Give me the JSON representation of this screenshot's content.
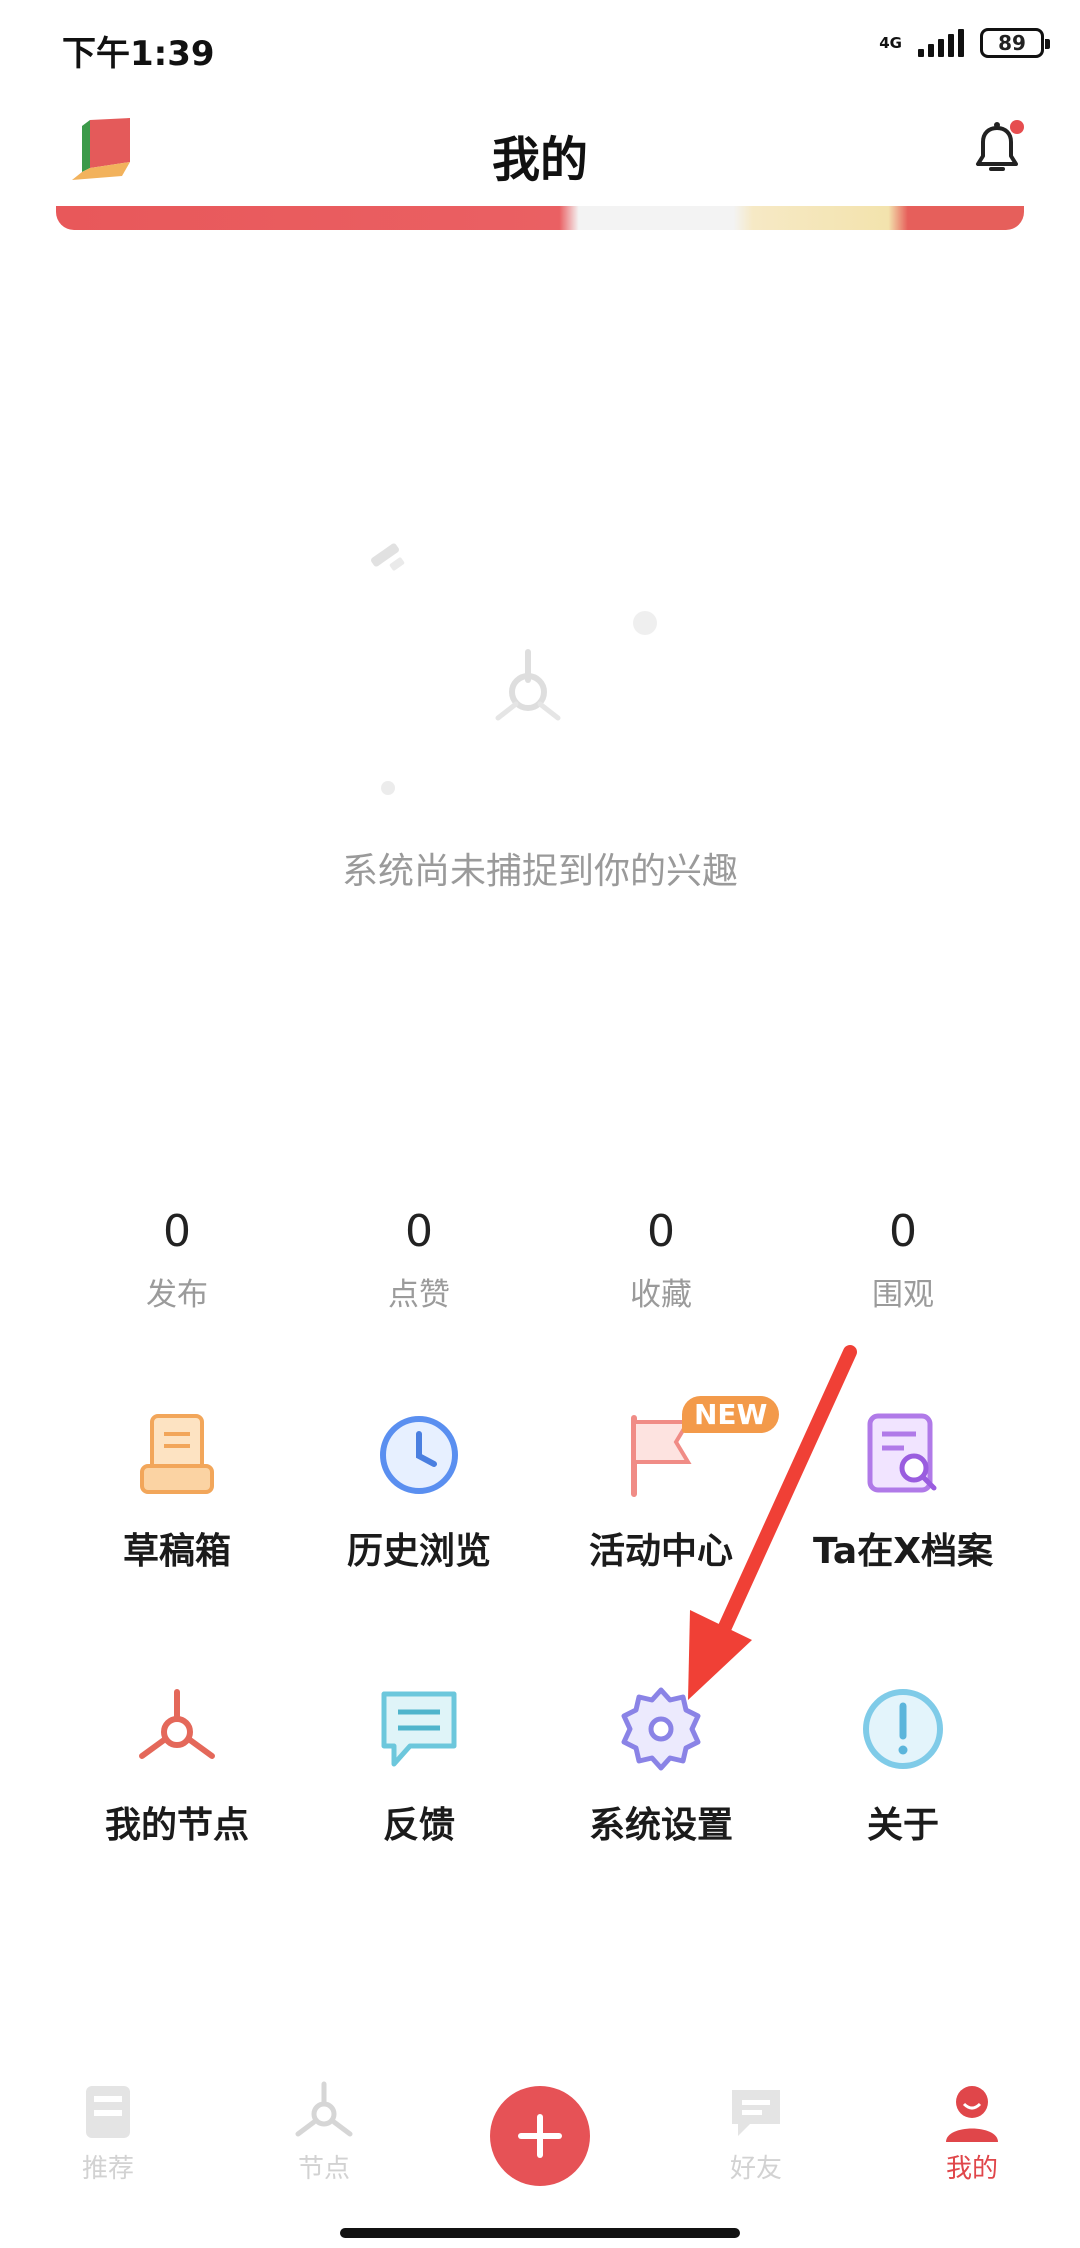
{
  "status": {
    "time": "下午1:39",
    "network": "4G",
    "battery": "89"
  },
  "header": {
    "title": "我的"
  },
  "empty_state": {
    "message": "系统尚未捕捉到你的兴趣"
  },
  "stats": [
    {
      "value": "0",
      "label": "发布"
    },
    {
      "value": "0",
      "label": "点赞"
    },
    {
      "value": "0",
      "label": "收藏"
    },
    {
      "value": "0",
      "label": "围观"
    }
  ],
  "grid": [
    {
      "label": "草稿箱",
      "icon": "drafts-icon"
    },
    {
      "label": "历史浏览",
      "icon": "clock-icon"
    },
    {
      "label": "活动中心",
      "icon": "flag-icon",
      "badge": "NEW"
    },
    {
      "label": "Ta在X档案",
      "icon": "profile-search-icon"
    },
    {
      "label": "我的节点",
      "icon": "node-icon"
    },
    {
      "label": "反馈",
      "icon": "chat-icon"
    },
    {
      "label": "系统设置",
      "icon": "gear-icon"
    },
    {
      "label": "关于",
      "icon": "info-icon"
    }
  ],
  "bottom_nav": [
    {
      "label": "推荐"
    },
    {
      "label": "节点"
    },
    {
      "label": "好友"
    },
    {
      "label": "我的"
    }
  ],
  "colors": {
    "accent": "#e65256",
    "badge": "#f39a4a",
    "muted": "#9b9b9b"
  }
}
